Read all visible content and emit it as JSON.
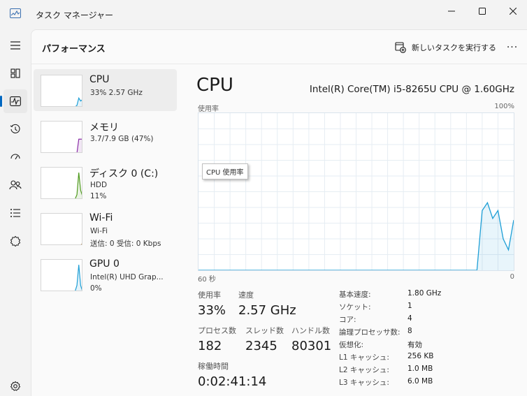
{
  "window": {
    "title": "タスク マネージャー",
    "icon": "task-manager-icon"
  },
  "nav": {
    "items": [
      {
        "icon": "hamburger-menu-icon"
      },
      {
        "icon": "processes-icon"
      },
      {
        "icon": "performance-icon",
        "active": true
      },
      {
        "icon": "app-history-icon"
      },
      {
        "icon": "startup-apps-icon"
      },
      {
        "icon": "users-icon"
      },
      {
        "icon": "details-icon"
      },
      {
        "icon": "services-icon"
      },
      {
        "icon": "settings-icon"
      }
    ]
  },
  "header": {
    "title": "パフォーマンス",
    "new_task_label": "新しいタスクを実行する",
    "more_label": "···"
  },
  "devices": [
    {
      "name": "CPU",
      "sub1": "33%  2.57 GHz",
      "sub2": "",
      "active": true,
      "color": "#1e9fd6",
      "spark": [
        0,
        0,
        0,
        0,
        0,
        0,
        0,
        0,
        0,
        0,
        0,
        0,
        0,
        0,
        0,
        0,
        0,
        0,
        0,
        0.05,
        0.3,
        0.2,
        0.25
      ]
    },
    {
      "name": "メモリ",
      "sub1": "3.7/7.9 GB (47%)",
      "sub2": "",
      "active": false,
      "color": "#8b2fa8",
      "spark": [
        0,
        0,
        0,
        0,
        0,
        0,
        0,
        0,
        0,
        0,
        0,
        0,
        0,
        0,
        0,
        0,
        0,
        0,
        0,
        0,
        0.47,
        0.47,
        0.47
      ]
    },
    {
      "name": "ディスク 0 (C:)",
      "sub1": "HDD",
      "sub2": "11%",
      "active": false,
      "color": "#4f9a1e",
      "spark": [
        0,
        0,
        0,
        0,
        0,
        0,
        0,
        0,
        0,
        0,
        0,
        0,
        0,
        0,
        0,
        0,
        0,
        0,
        0,
        0.15,
        0.9,
        0.3,
        0.1
      ]
    },
    {
      "name": "Wi-Fi",
      "sub1": "Wi-Fi",
      "sub2": "送信: 0 受信: 0 Kbps",
      "active": false,
      "color": "#a86b1e",
      "spark": [
        0,
        0,
        0,
        0,
        0,
        0,
        0,
        0,
        0,
        0,
        0,
        0,
        0,
        0,
        0,
        0,
        0,
        0,
        0,
        0,
        0,
        0,
        0.05
      ]
    },
    {
      "name": "GPU 0",
      "sub1": "Intel(R) UHD Grap...",
      "sub2": "0%",
      "active": false,
      "color": "#1e9fd6",
      "spark": [
        0,
        0,
        0,
        0,
        0,
        0,
        0,
        0,
        0,
        0,
        0,
        0,
        0,
        0,
        0,
        0,
        0,
        0,
        0,
        0.2,
        0.9,
        0.2,
        0
      ]
    }
  ],
  "cpu": {
    "title": "CPU",
    "model": "Intel(R) Core(TM) i5-8265U CPU @ 1.60GHz",
    "chart_top_label": "使用率",
    "chart_max_label": "100%",
    "chart_tooltip": "CPU 使用率",
    "chart_x_start": "60 秒",
    "chart_x_end": "0",
    "usage_label": "使用率",
    "usage_value": "33%",
    "speed_label": "速度",
    "speed_value": "2.57 GHz",
    "processes_label": "プロセス数",
    "processes_value": "182",
    "threads_label": "スレッド数",
    "threads_value": "2345",
    "handles_label": "ハンドル数",
    "handles_value": "80301",
    "uptime_label": "稼働時間",
    "uptime_value": "0:02:41:14"
  },
  "specs": [
    {
      "key": "基本速度:",
      "value": "1.80 GHz"
    },
    {
      "key": "ソケット:",
      "value": "1"
    },
    {
      "key": "コア:",
      "value": "4"
    },
    {
      "key": "論理プロセッサ数:",
      "value": "8"
    },
    {
      "key": "仮想化:",
      "value": "有効"
    },
    {
      "key": "L1 キャッシュ:",
      "value": "256 KB"
    },
    {
      "key": "L2 キャッシュ:",
      "value": "1.0 MB"
    },
    {
      "key": "L3 キャッシュ:",
      "value": "6.0 MB"
    }
  ],
  "chart_data": {
    "type": "area",
    "x": [
      60,
      7,
      6,
      5,
      4,
      3,
      2,
      1,
      0
    ],
    "series": [
      {
        "values": [
          0,
          0,
          38,
          43,
          33,
          38,
          20,
          13,
          32
        ]
      }
    ],
    "ylim": [
      0,
      100
    ],
    "grid": true
  }
}
